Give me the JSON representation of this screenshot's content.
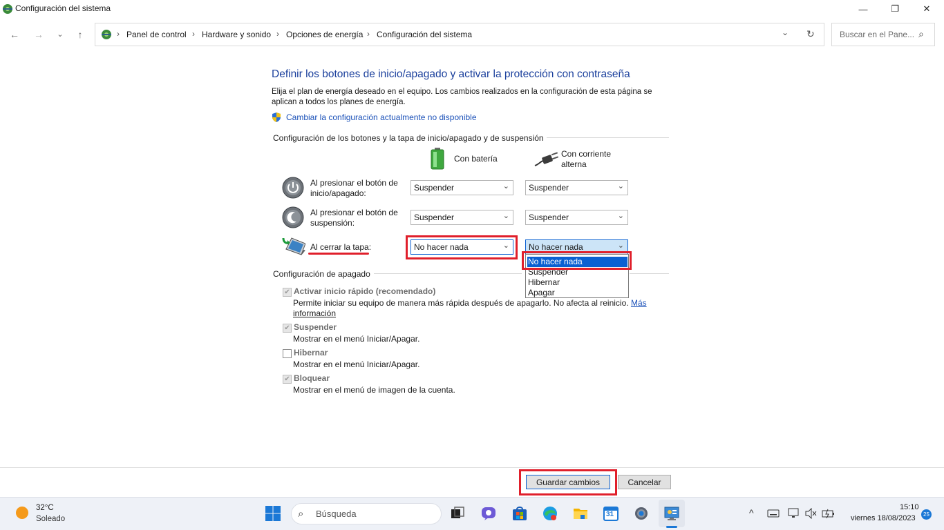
{
  "window": {
    "title": "Configuración del sistema",
    "controls": {
      "minimize": "—",
      "maximize": "❐",
      "close": "✕"
    }
  },
  "nav": {
    "back": "←",
    "forward": "→",
    "recent": "⌄",
    "up": "↑",
    "breadcrumbs": [
      "Panel de control",
      "Hardware y sonido",
      "Opciones de energía",
      "Configuración del sistema"
    ],
    "separator": "›",
    "dropdown_glyph": "⌄",
    "refresh_glyph": "↻",
    "search_placeholder": "Buscar en el Pane...",
    "search_glyph": "⌕"
  },
  "main": {
    "heading": "Definir los botones de inicio/apagado y activar la protección con contraseña",
    "description": "Elija el plan de energía deseado en el equipo. Los cambios realizados en la configuración de esta página se aplican a todos los planes de energía.",
    "change_link": "Cambiar la configuración actualmente no disponible",
    "buttons_section_title": "Configuración de los botones y la tapa de inicio/apagado y de suspensión",
    "col_battery": "Con batería",
    "col_ac_line1": "Con corriente",
    "col_ac_line2": "alterna",
    "rows": [
      {
        "label_line1": "Al presionar el botón de",
        "label_line2": "inicio/apagado:",
        "battery": "Suspender",
        "ac": "Suspender"
      },
      {
        "label_line1": "Al presionar el botón de",
        "label_line2": "suspensión:",
        "battery": "Suspender",
        "ac": "Suspender"
      },
      {
        "label_line1": "Al cerrar la tapa:",
        "label_line2": "",
        "battery": "No hacer nada",
        "ac": "No hacer nada"
      }
    ],
    "dropdown_options": [
      "No hacer nada",
      "Suspender",
      "Hibernar",
      "Apagar"
    ],
    "dropdown_selected": "No hacer nada",
    "shutdown_section_title": "Configuración de apagado",
    "shutdown_items": [
      {
        "label": "Activar inicio rápido (recomendado)",
        "checked": true,
        "desc_line1": "Permite iniciar su equipo de manera más rápida después de apagarlo. No afecta al reinicio.",
        "desc_link1": "Más",
        "desc_link2": "información"
      },
      {
        "label": "Suspender",
        "checked": true,
        "desc": "Mostrar en el menú Iniciar/Apagar."
      },
      {
        "label": "Hibernar",
        "checked": false,
        "desc": "Mostrar en el menú Iniciar/Apagar."
      },
      {
        "label": "Bloquear",
        "checked": true,
        "desc": "Mostrar en el menú de imagen de la cuenta."
      }
    ],
    "checkmark_glyph": "✔"
  },
  "footer": {
    "save": "Guardar cambios",
    "cancel": "Cancelar"
  },
  "taskbar": {
    "weather_temp": "32°C",
    "weather_desc": "Soleado",
    "search_placeholder": "Búsqueda",
    "calendar_day": "31",
    "time": "15:10",
    "date": "viernes 18/08/2023",
    "notification_count": "25",
    "tray_chevron": "^"
  },
  "colors": {
    "accent": "#0a60d2",
    "heading": "#1a3f9c",
    "link": "#1a50b8",
    "highlight": "#e01f2b"
  }
}
